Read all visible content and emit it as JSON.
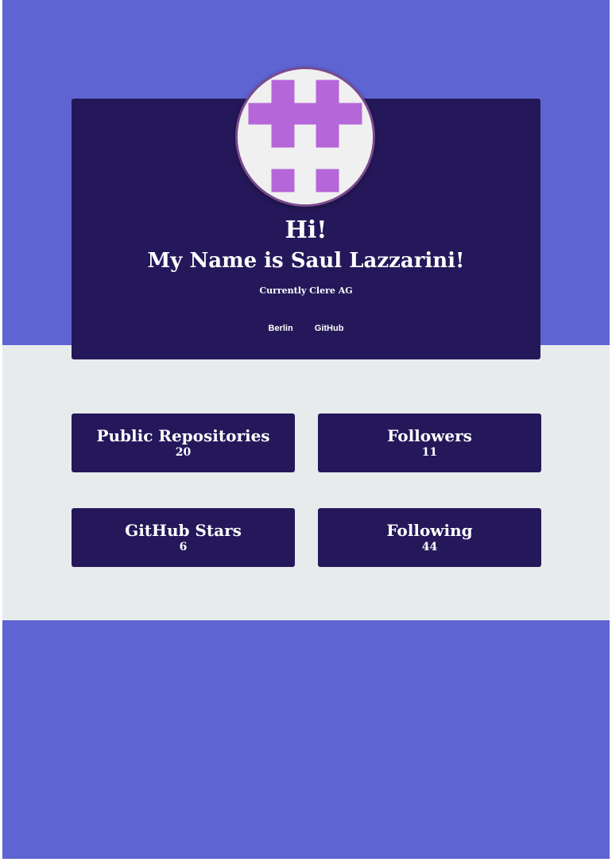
{
  "colors": {
    "accent_band": "#5e64d2",
    "middle_band": "#e8ebec",
    "card_background": "#25185a",
    "avatar_pattern": "#b566d8",
    "text": "#ffffff"
  },
  "profile": {
    "greeting": "Hi!",
    "name_line": "My Name is Saul Lazzarini!",
    "company_line": "Currently Clere AG",
    "avatar_icon": "identicon-avatar",
    "links": [
      {
        "label": "Berlin"
      },
      {
        "label": "GitHub"
      }
    ]
  },
  "stats": [
    {
      "label": "Public Repositories",
      "value": "20"
    },
    {
      "label": "Followers",
      "value": "11"
    },
    {
      "label": "GitHub Stars",
      "value": "6"
    },
    {
      "label": "Following",
      "value": "44"
    }
  ]
}
